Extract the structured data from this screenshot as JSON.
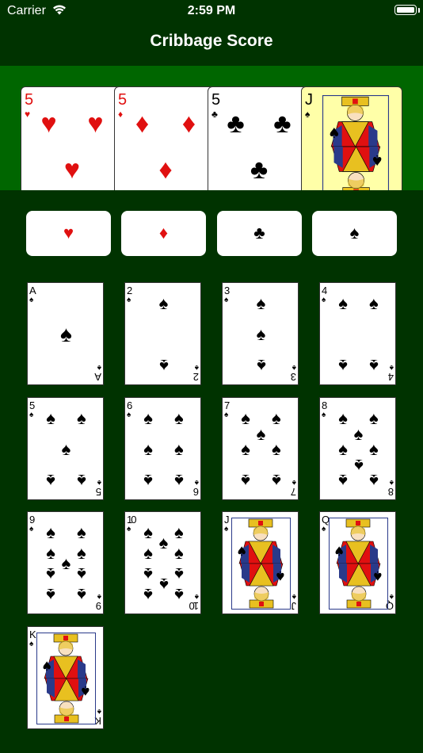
{
  "status_bar": {
    "carrier": "Carrier",
    "time": "2:59 PM"
  },
  "nav": {
    "title": "Cribbage Score"
  },
  "colors": {
    "table_green": "#003300",
    "hand_green": "#006600",
    "red_suit": "#e01010",
    "selected_card": "#ffffa8"
  },
  "hand": [
    {
      "rank": "5",
      "suit": "♥",
      "color": "red",
      "selected": false
    },
    {
      "rank": "5",
      "suit": "♦",
      "color": "red",
      "selected": false
    },
    {
      "rank": "5",
      "suit": "♣",
      "color": "black",
      "selected": false
    },
    {
      "rank": "J",
      "suit": "♠",
      "color": "black",
      "selected": true
    }
  ],
  "suit_buttons": [
    {
      "suit": "♥",
      "name": "hearts",
      "color": "red"
    },
    {
      "suit": "♦",
      "name": "diamonds",
      "color": "red"
    },
    {
      "suit": "♣",
      "name": "clubs",
      "color": "black"
    },
    {
      "suit": "♠",
      "name": "spades",
      "color": "black"
    }
  ],
  "deck": {
    "suit": "♠",
    "cards": [
      {
        "rank": "A"
      },
      {
        "rank": "2"
      },
      {
        "rank": "3"
      },
      {
        "rank": "4"
      },
      {
        "rank": "5"
      },
      {
        "rank": "6"
      },
      {
        "rank": "7"
      },
      {
        "rank": "8"
      },
      {
        "rank": "9"
      },
      {
        "rank": "10"
      },
      {
        "rank": "J"
      },
      {
        "rank": "Q"
      },
      {
        "rank": "K"
      }
    ]
  }
}
